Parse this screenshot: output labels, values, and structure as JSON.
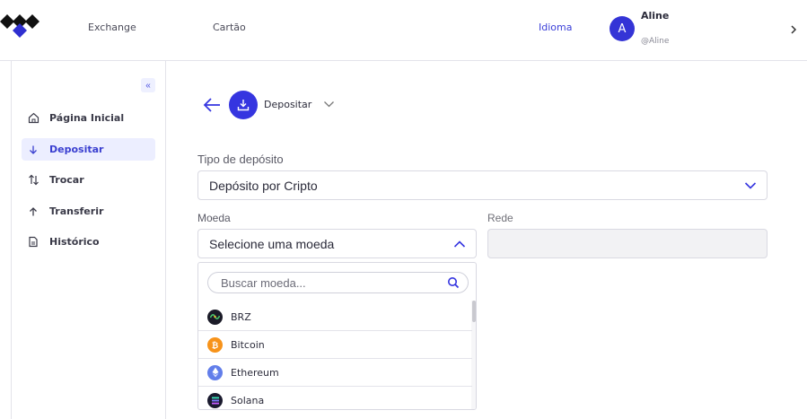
{
  "header": {
    "nav": [
      "Exchange",
      "Cartão"
    ],
    "language_label": "Idioma",
    "user": {
      "initial": "A",
      "name": "Aline",
      "handle": "@Aline"
    }
  },
  "sidebar": {
    "collapse_glyph": "«",
    "items": [
      {
        "label": "Página Inicial",
        "icon": "home-icon"
      },
      {
        "label": "Depositar",
        "icon": "arrow-down-icon",
        "active": true
      },
      {
        "label": "Trocar",
        "icon": "swap-icon"
      },
      {
        "label": "Transferir",
        "icon": "arrow-up-icon"
      },
      {
        "label": "Histórico",
        "icon": "document-icon"
      }
    ]
  },
  "main": {
    "action_title": "Depositar",
    "deposit_type": {
      "label": "Tipo de depósito",
      "value": "Depósito por Cripto"
    },
    "currency": {
      "label": "Moeda",
      "value": "Selecione uma moeda"
    },
    "network": {
      "label": "Rede",
      "value": ""
    },
    "dropdown": {
      "search_placeholder": "Buscar moeda...",
      "coins": [
        {
          "name": "BRZ",
          "icon": "brz-icon"
        },
        {
          "name": "Bitcoin",
          "icon": "bitcoin-icon",
          "color": "#f7931a"
        },
        {
          "name": "Ethereum",
          "icon": "ethereum-icon",
          "color": "#627eea"
        },
        {
          "name": "Solana",
          "icon": "solana-icon",
          "color": "#1a1a2e"
        }
      ]
    }
  },
  "colors": {
    "accent": "#3535e0",
    "active_bg": "#eceeff"
  }
}
